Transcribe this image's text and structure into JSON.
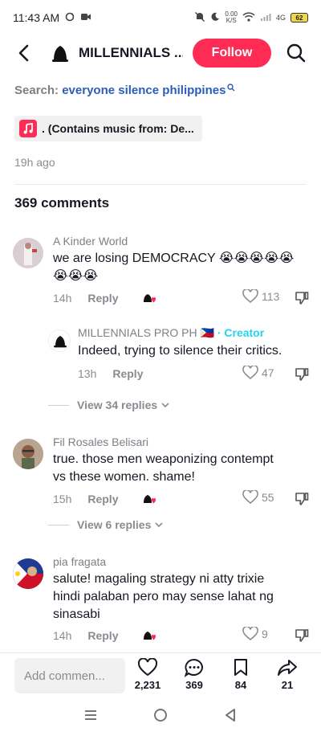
{
  "status_bar": {
    "time": "11:43 AM",
    "net_speed": "0.00",
    "net_unit": "K/S",
    "signal": "4G",
    "battery": "62"
  },
  "header": {
    "title": "MILLENNIALS ...",
    "follow_label": "Follow"
  },
  "search": {
    "prefix": "Search:",
    "query": "everyone silence philippines"
  },
  "music": {
    "text": ". (Contains music from: De..."
  },
  "post": {
    "time": "19h ago"
  },
  "comments_count": "369 comments",
  "comments": [
    {
      "user": "A Kinder World",
      "text_line1": "we are losing DEMOCRACY 😭😭😭😭😭",
      "text_line2": "😭😭😭",
      "time": "14h",
      "reply_label": "Reply",
      "likes": "113"
    },
    {
      "user": "MILLENNIALS PRO PH",
      "flag": "🇵🇭",
      "separator": "·",
      "creator_label": "Creator",
      "text_line1": "Indeed, trying to silence their critics.",
      "time": "13h",
      "reply_label": "Reply",
      "likes": "47"
    },
    {
      "user": "Fil Rosales Belisari",
      "text_line1": "true. those men weaponizing contempt",
      "text_line2": "vs these women. shame!",
      "time": "15h",
      "reply_label": "Reply",
      "likes": "55"
    },
    {
      "user": "pia fragata",
      "text_line1": "salute! magaling strategy ni atty trixie",
      "text_line2": "hindi palaban pero may sense lahat ng",
      "text_line3": "sinasabi",
      "time": "14h",
      "reply_label": "Reply",
      "likes": "9"
    }
  ],
  "view_replies": [
    "View 34 replies",
    "View 6 replies"
  ],
  "bottom_bar": {
    "add_comment_placeholder": "Add commen...",
    "likes": "2,231",
    "comments": "369",
    "saves": "84",
    "shares": "21"
  },
  "colors": {
    "accent": "#fe2c55",
    "link": "#2b5db8",
    "creator": "#20d5ec",
    "muted": "#8a8b91"
  },
  "icons": [
    "back-arrow-icon",
    "bell-avatar-icon",
    "search-icon",
    "music-note-icon",
    "heart-icon",
    "dislike-icon",
    "comment-icon",
    "bookmark-icon",
    "share-icon",
    "menu-icon",
    "home-circle-icon",
    "back-triangle-icon"
  ]
}
